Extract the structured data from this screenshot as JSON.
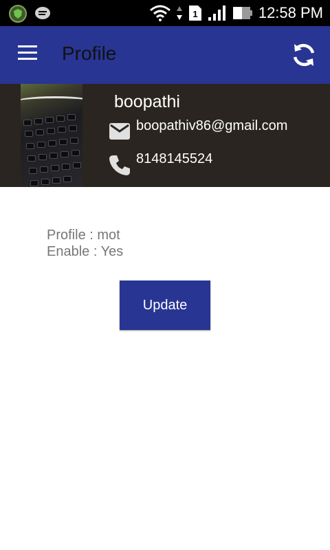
{
  "status_bar": {
    "time": "12:58 PM",
    "sim_slot": "1",
    "icons": [
      "shield-app-icon",
      "message-icon",
      "wifi-icon",
      "data-arrows-icon",
      "sim-icon",
      "signal-icon",
      "battery-icon"
    ]
  },
  "app_bar": {
    "title": "Profile",
    "menu_icon": "hamburger-menu-icon",
    "refresh_icon": "refresh-icon",
    "color": "#283593"
  },
  "profile": {
    "name": "boopathi",
    "email": "boopathiv86@gmail.com",
    "phone": "8148145524",
    "header_color": "#2a2520"
  },
  "details": {
    "profile_line": "Profile : mot",
    "enable_line": "Enable : Yes"
  },
  "actions": {
    "update_label": "Update"
  }
}
